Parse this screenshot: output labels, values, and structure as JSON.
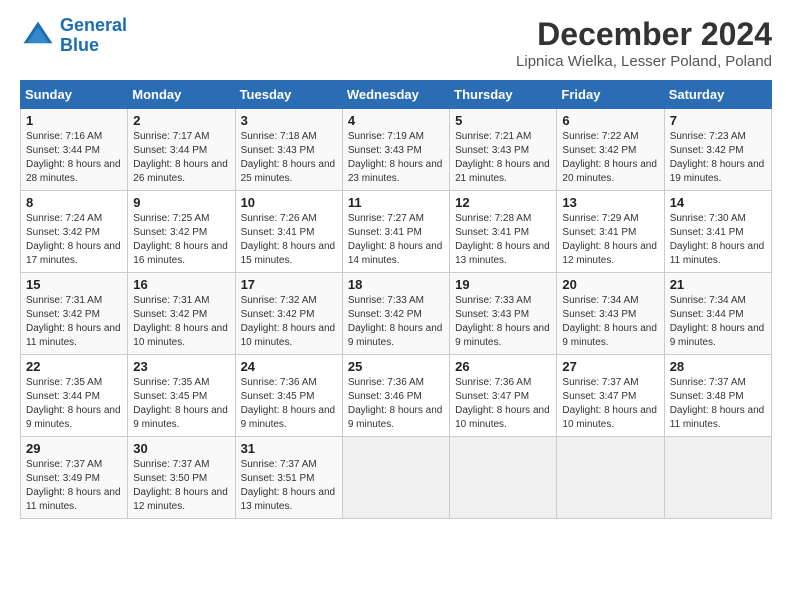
{
  "header": {
    "logo_line1": "General",
    "logo_line2": "Blue",
    "month": "December 2024",
    "location": "Lipnica Wielka, Lesser Poland, Poland"
  },
  "weekdays": [
    "Sunday",
    "Monday",
    "Tuesday",
    "Wednesday",
    "Thursday",
    "Friday",
    "Saturday"
  ],
  "weeks": [
    [
      {
        "day": "1",
        "sunrise": "Sunrise: 7:16 AM",
        "sunset": "Sunset: 3:44 PM",
        "daylight": "Daylight: 8 hours and 28 minutes."
      },
      {
        "day": "2",
        "sunrise": "Sunrise: 7:17 AM",
        "sunset": "Sunset: 3:44 PM",
        "daylight": "Daylight: 8 hours and 26 minutes."
      },
      {
        "day": "3",
        "sunrise": "Sunrise: 7:18 AM",
        "sunset": "Sunset: 3:43 PM",
        "daylight": "Daylight: 8 hours and 25 minutes."
      },
      {
        "day": "4",
        "sunrise": "Sunrise: 7:19 AM",
        "sunset": "Sunset: 3:43 PM",
        "daylight": "Daylight: 8 hours and 23 minutes."
      },
      {
        "day": "5",
        "sunrise": "Sunrise: 7:21 AM",
        "sunset": "Sunset: 3:43 PM",
        "daylight": "Daylight: 8 hours and 21 minutes."
      },
      {
        "day": "6",
        "sunrise": "Sunrise: 7:22 AM",
        "sunset": "Sunset: 3:42 PM",
        "daylight": "Daylight: 8 hours and 20 minutes."
      },
      {
        "day": "7",
        "sunrise": "Sunrise: 7:23 AM",
        "sunset": "Sunset: 3:42 PM",
        "daylight": "Daylight: 8 hours and 19 minutes."
      }
    ],
    [
      {
        "day": "8",
        "sunrise": "Sunrise: 7:24 AM",
        "sunset": "Sunset: 3:42 PM",
        "daylight": "Daylight: 8 hours and 17 minutes."
      },
      {
        "day": "9",
        "sunrise": "Sunrise: 7:25 AM",
        "sunset": "Sunset: 3:42 PM",
        "daylight": "Daylight: 8 hours and 16 minutes."
      },
      {
        "day": "10",
        "sunrise": "Sunrise: 7:26 AM",
        "sunset": "Sunset: 3:41 PM",
        "daylight": "Daylight: 8 hours and 15 minutes."
      },
      {
        "day": "11",
        "sunrise": "Sunrise: 7:27 AM",
        "sunset": "Sunset: 3:41 PM",
        "daylight": "Daylight: 8 hours and 14 minutes."
      },
      {
        "day": "12",
        "sunrise": "Sunrise: 7:28 AM",
        "sunset": "Sunset: 3:41 PM",
        "daylight": "Daylight: 8 hours and 13 minutes."
      },
      {
        "day": "13",
        "sunrise": "Sunrise: 7:29 AM",
        "sunset": "Sunset: 3:41 PM",
        "daylight": "Daylight: 8 hours and 12 minutes."
      },
      {
        "day": "14",
        "sunrise": "Sunrise: 7:30 AM",
        "sunset": "Sunset: 3:41 PM",
        "daylight": "Daylight: 8 hours and 11 minutes."
      }
    ],
    [
      {
        "day": "15",
        "sunrise": "Sunrise: 7:31 AM",
        "sunset": "Sunset: 3:42 PM",
        "daylight": "Daylight: 8 hours and 11 minutes."
      },
      {
        "day": "16",
        "sunrise": "Sunrise: 7:31 AM",
        "sunset": "Sunset: 3:42 PM",
        "daylight": "Daylight: 8 hours and 10 minutes."
      },
      {
        "day": "17",
        "sunrise": "Sunrise: 7:32 AM",
        "sunset": "Sunset: 3:42 PM",
        "daylight": "Daylight: 8 hours and 10 minutes."
      },
      {
        "day": "18",
        "sunrise": "Sunrise: 7:33 AM",
        "sunset": "Sunset: 3:42 PM",
        "daylight": "Daylight: 8 hours and 9 minutes."
      },
      {
        "day": "19",
        "sunrise": "Sunrise: 7:33 AM",
        "sunset": "Sunset: 3:43 PM",
        "daylight": "Daylight: 8 hours and 9 minutes."
      },
      {
        "day": "20",
        "sunrise": "Sunrise: 7:34 AM",
        "sunset": "Sunset: 3:43 PM",
        "daylight": "Daylight: 8 hours and 9 minutes."
      },
      {
        "day": "21",
        "sunrise": "Sunrise: 7:34 AM",
        "sunset": "Sunset: 3:44 PM",
        "daylight": "Daylight: 8 hours and 9 minutes."
      }
    ],
    [
      {
        "day": "22",
        "sunrise": "Sunrise: 7:35 AM",
        "sunset": "Sunset: 3:44 PM",
        "daylight": "Daylight: 8 hours and 9 minutes."
      },
      {
        "day": "23",
        "sunrise": "Sunrise: 7:35 AM",
        "sunset": "Sunset: 3:45 PM",
        "daylight": "Daylight: 8 hours and 9 minutes."
      },
      {
        "day": "24",
        "sunrise": "Sunrise: 7:36 AM",
        "sunset": "Sunset: 3:45 PM",
        "daylight": "Daylight: 8 hours and 9 minutes."
      },
      {
        "day": "25",
        "sunrise": "Sunrise: 7:36 AM",
        "sunset": "Sunset: 3:46 PM",
        "daylight": "Daylight: 8 hours and 9 minutes."
      },
      {
        "day": "26",
        "sunrise": "Sunrise: 7:36 AM",
        "sunset": "Sunset: 3:47 PM",
        "daylight": "Daylight: 8 hours and 10 minutes."
      },
      {
        "day": "27",
        "sunrise": "Sunrise: 7:37 AM",
        "sunset": "Sunset: 3:47 PM",
        "daylight": "Daylight: 8 hours and 10 minutes."
      },
      {
        "day": "28",
        "sunrise": "Sunrise: 7:37 AM",
        "sunset": "Sunset: 3:48 PM",
        "daylight": "Daylight: 8 hours and 11 minutes."
      }
    ],
    [
      {
        "day": "29",
        "sunrise": "Sunrise: 7:37 AM",
        "sunset": "Sunset: 3:49 PM",
        "daylight": "Daylight: 8 hours and 11 minutes."
      },
      {
        "day": "30",
        "sunrise": "Sunrise: 7:37 AM",
        "sunset": "Sunset: 3:50 PM",
        "daylight": "Daylight: 8 hours and 12 minutes."
      },
      {
        "day": "31",
        "sunrise": "Sunrise: 7:37 AM",
        "sunset": "Sunset: 3:51 PM",
        "daylight": "Daylight: 8 hours and 13 minutes."
      },
      null,
      null,
      null,
      null
    ]
  ]
}
